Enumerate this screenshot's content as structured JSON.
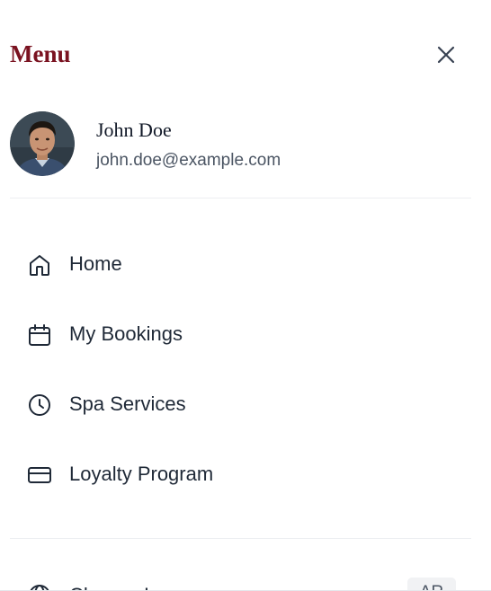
{
  "menu": {
    "title": "Menu",
    "close_icon": "close-icon"
  },
  "profile": {
    "name": "John Doe",
    "email": "john.doe@example.com",
    "avatar_icon": "user-avatar"
  },
  "nav": {
    "items": [
      {
        "label": "Home",
        "icon": "home-icon"
      },
      {
        "label": "My Bookings",
        "icon": "calendar-icon"
      },
      {
        "label": "Spa Services",
        "icon": "clock-icon"
      },
      {
        "label": "Loyalty Program",
        "icon": "credit-card-icon"
      }
    ]
  },
  "language": {
    "label": "Change Language",
    "badge": "AR",
    "icon": "globe-icon"
  },
  "colors": {
    "title": "#7a1220",
    "text": "#1f2937",
    "muted": "#4b5563",
    "divider": "#eceef1"
  }
}
